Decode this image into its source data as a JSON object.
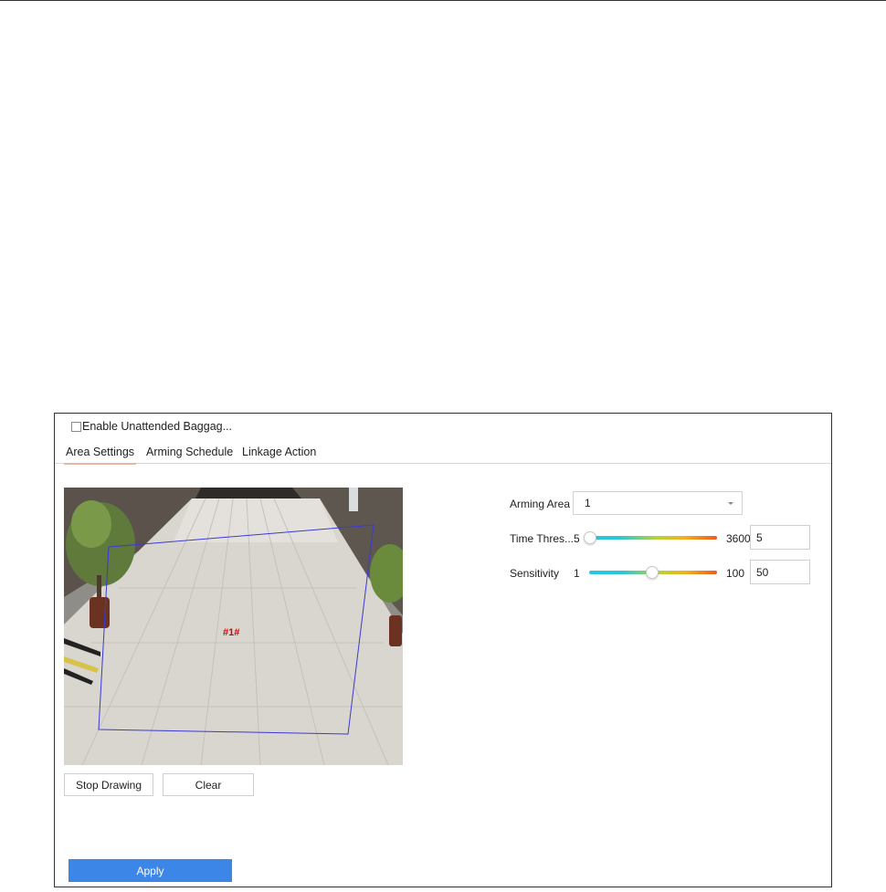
{
  "enable": {
    "label": "Enable Unattended Baggag...",
    "checked": false
  },
  "tabs": [
    {
      "label": "Area Settings",
      "active": true
    },
    {
      "label": "Arming Schedule",
      "active": false
    },
    {
      "label": "Linkage Action",
      "active": false
    }
  ],
  "video": {
    "region_label": "#1#"
  },
  "buttons": {
    "stop_drawing": "Stop Drawing",
    "clear": "Clear",
    "apply": "Apply"
  },
  "arming_area": {
    "label": "Arming Area",
    "value": "1"
  },
  "time_threshold": {
    "label": "Time Thres...",
    "min": "5",
    "max": "3600",
    "value": "5"
  },
  "sensitivity": {
    "label": "Sensitivity",
    "min": "1",
    "max": "100",
    "value": "50"
  },
  "colors": {
    "accent": "#3b86e6",
    "tab_underline": "#e5b9a1",
    "region_outline": "#3a3ad8",
    "region_label": "#e00000"
  }
}
